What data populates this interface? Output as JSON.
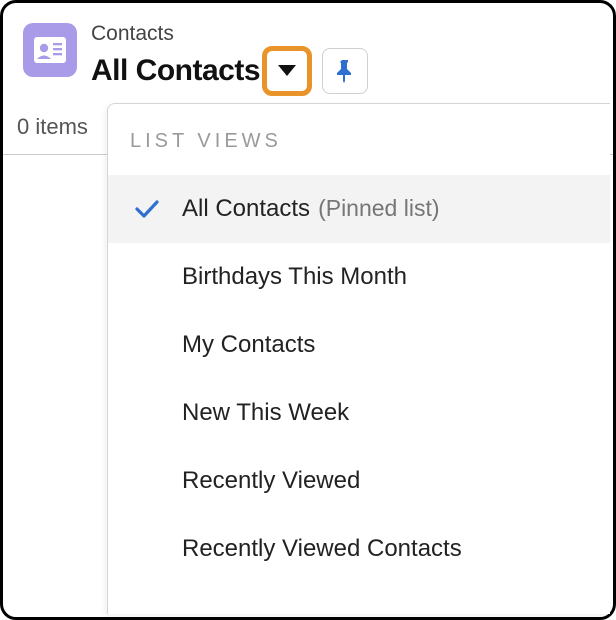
{
  "header": {
    "object_label": "Contacts",
    "list_name": "All Contacts"
  },
  "subbar": {
    "items_count": "0 items"
  },
  "dropdown": {
    "section_label": "LIST VIEWS",
    "items": [
      {
        "label": "All Contacts",
        "suffix": "(Pinned list)",
        "selected": true
      },
      {
        "label": "Birthdays This Month",
        "suffix": "",
        "selected": false
      },
      {
        "label": "My Contacts",
        "suffix": "",
        "selected": false
      },
      {
        "label": "New This Week",
        "suffix": "",
        "selected": false
      },
      {
        "label": "Recently Viewed",
        "suffix": "",
        "selected": false
      },
      {
        "label": "Recently Viewed Contacts",
        "suffix": "",
        "selected": false
      }
    ]
  },
  "colors": {
    "highlight": "#e8942b",
    "icon_bg": "#a99be8",
    "pin": "#2f6fd0",
    "check": "#2f6fd0"
  }
}
